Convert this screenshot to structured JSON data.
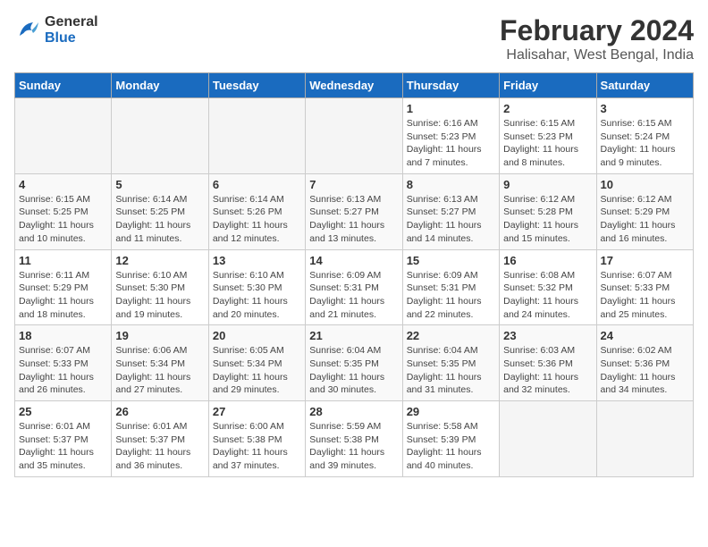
{
  "logo": {
    "line1": "General",
    "line2": "Blue"
  },
  "title": "February 2024",
  "subtitle": "Halisahar, West Bengal, India",
  "days_of_week": [
    "Sunday",
    "Monday",
    "Tuesday",
    "Wednesday",
    "Thursday",
    "Friday",
    "Saturday"
  ],
  "weeks": [
    [
      {
        "day": "",
        "info": ""
      },
      {
        "day": "",
        "info": ""
      },
      {
        "day": "",
        "info": ""
      },
      {
        "day": "",
        "info": ""
      },
      {
        "day": "1",
        "info": "Sunrise: 6:16 AM\nSunset: 5:23 PM\nDaylight: 11 hours\nand 7 minutes."
      },
      {
        "day": "2",
        "info": "Sunrise: 6:15 AM\nSunset: 5:23 PM\nDaylight: 11 hours\nand 8 minutes."
      },
      {
        "day": "3",
        "info": "Sunrise: 6:15 AM\nSunset: 5:24 PM\nDaylight: 11 hours\nand 9 minutes."
      }
    ],
    [
      {
        "day": "4",
        "info": "Sunrise: 6:15 AM\nSunset: 5:25 PM\nDaylight: 11 hours\nand 10 minutes."
      },
      {
        "day": "5",
        "info": "Sunrise: 6:14 AM\nSunset: 5:25 PM\nDaylight: 11 hours\nand 11 minutes."
      },
      {
        "day": "6",
        "info": "Sunrise: 6:14 AM\nSunset: 5:26 PM\nDaylight: 11 hours\nand 12 minutes."
      },
      {
        "day": "7",
        "info": "Sunrise: 6:13 AM\nSunset: 5:27 PM\nDaylight: 11 hours\nand 13 minutes."
      },
      {
        "day": "8",
        "info": "Sunrise: 6:13 AM\nSunset: 5:27 PM\nDaylight: 11 hours\nand 14 minutes."
      },
      {
        "day": "9",
        "info": "Sunrise: 6:12 AM\nSunset: 5:28 PM\nDaylight: 11 hours\nand 15 minutes."
      },
      {
        "day": "10",
        "info": "Sunrise: 6:12 AM\nSunset: 5:29 PM\nDaylight: 11 hours\nand 16 minutes."
      }
    ],
    [
      {
        "day": "11",
        "info": "Sunrise: 6:11 AM\nSunset: 5:29 PM\nDaylight: 11 hours\nand 18 minutes."
      },
      {
        "day": "12",
        "info": "Sunrise: 6:10 AM\nSunset: 5:30 PM\nDaylight: 11 hours\nand 19 minutes."
      },
      {
        "day": "13",
        "info": "Sunrise: 6:10 AM\nSunset: 5:30 PM\nDaylight: 11 hours\nand 20 minutes."
      },
      {
        "day": "14",
        "info": "Sunrise: 6:09 AM\nSunset: 5:31 PM\nDaylight: 11 hours\nand 21 minutes."
      },
      {
        "day": "15",
        "info": "Sunrise: 6:09 AM\nSunset: 5:31 PM\nDaylight: 11 hours\nand 22 minutes."
      },
      {
        "day": "16",
        "info": "Sunrise: 6:08 AM\nSunset: 5:32 PM\nDaylight: 11 hours\nand 24 minutes."
      },
      {
        "day": "17",
        "info": "Sunrise: 6:07 AM\nSunset: 5:33 PM\nDaylight: 11 hours\nand 25 minutes."
      }
    ],
    [
      {
        "day": "18",
        "info": "Sunrise: 6:07 AM\nSunset: 5:33 PM\nDaylight: 11 hours\nand 26 minutes."
      },
      {
        "day": "19",
        "info": "Sunrise: 6:06 AM\nSunset: 5:34 PM\nDaylight: 11 hours\nand 27 minutes."
      },
      {
        "day": "20",
        "info": "Sunrise: 6:05 AM\nSunset: 5:34 PM\nDaylight: 11 hours\nand 29 minutes."
      },
      {
        "day": "21",
        "info": "Sunrise: 6:04 AM\nSunset: 5:35 PM\nDaylight: 11 hours\nand 30 minutes."
      },
      {
        "day": "22",
        "info": "Sunrise: 6:04 AM\nSunset: 5:35 PM\nDaylight: 11 hours\nand 31 minutes."
      },
      {
        "day": "23",
        "info": "Sunrise: 6:03 AM\nSunset: 5:36 PM\nDaylight: 11 hours\nand 32 minutes."
      },
      {
        "day": "24",
        "info": "Sunrise: 6:02 AM\nSunset: 5:36 PM\nDaylight: 11 hours\nand 34 minutes."
      }
    ],
    [
      {
        "day": "25",
        "info": "Sunrise: 6:01 AM\nSunset: 5:37 PM\nDaylight: 11 hours\nand 35 minutes."
      },
      {
        "day": "26",
        "info": "Sunrise: 6:01 AM\nSunset: 5:37 PM\nDaylight: 11 hours\nand 36 minutes."
      },
      {
        "day": "27",
        "info": "Sunrise: 6:00 AM\nSunset: 5:38 PM\nDaylight: 11 hours\nand 37 minutes."
      },
      {
        "day": "28",
        "info": "Sunrise: 5:59 AM\nSunset: 5:38 PM\nDaylight: 11 hours\nand 39 minutes."
      },
      {
        "day": "29",
        "info": "Sunrise: 5:58 AM\nSunset: 5:39 PM\nDaylight: 11 hours\nand 40 minutes."
      },
      {
        "day": "",
        "info": ""
      },
      {
        "day": "",
        "info": ""
      }
    ]
  ]
}
